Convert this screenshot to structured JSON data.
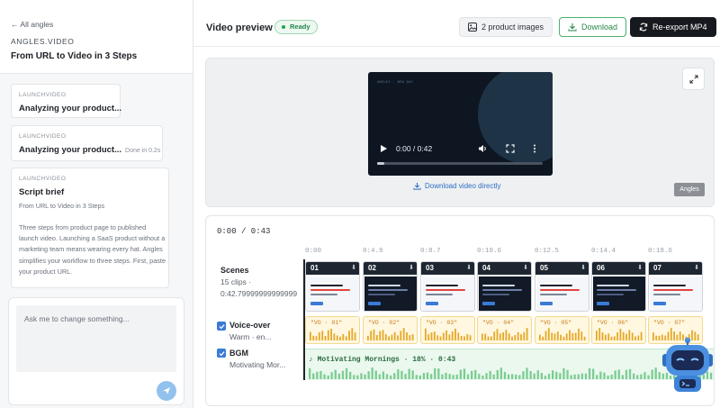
{
  "sidebar": {
    "back_label": "All angles",
    "brand": "ANGLES.VIDEO",
    "title": "From URL to Video in 3 Steps",
    "cards": [
      {
        "label": "LAUNCHVIDEO",
        "title": "Analyzing your product...",
        "meta": ""
      },
      {
        "label": "LAUNCHVIDEO",
        "title": "Analyzing your product...",
        "meta": "Done in 0.2s"
      },
      {
        "label": "LAUNCHVIDEO",
        "title": "Script brief",
        "subtitle": "From URL to Video in 3 Steps",
        "paragraph": "Three steps from product page to published launch video. Launching a SaaS product without a marketing team means wearing every hat. Angles simplifies your workflow to three steps. First, paste your product URL."
      }
    ],
    "chat": {
      "placeholder": "Ask me to change something..."
    }
  },
  "header": {
    "title": "Video preview",
    "status": "Ready",
    "images_button": "2 product images",
    "download_button": "Download",
    "reexport_button": "Re-export MP4"
  },
  "preview": {
    "video_small_text": "ANGLES · NEW DAY",
    "time_display": "0:00 / 0:42",
    "download_link": "Download video directly",
    "watermark": "Angles"
  },
  "timeline": {
    "current_time": "0:00 / 0:43",
    "ticks": [
      "0:00",
      "0:4.9",
      "0:8.7",
      "0:10.6",
      "0:12.5",
      "0:14.4",
      "0:18.6"
    ],
    "scenes_track": {
      "name": "Scenes",
      "sub1": "15 clips ·",
      "sub2": "0:42.79999999999999"
    },
    "scenes": [
      {
        "num": "01",
        "thumb": "light"
      },
      {
        "num": "02",
        "thumb": "dark"
      },
      {
        "num": "03",
        "thumb": "light"
      },
      {
        "num": "04",
        "thumb": "dark"
      },
      {
        "num": "05",
        "thumb": "light"
      },
      {
        "num": "06",
        "thumb": "dark"
      },
      {
        "num": "07",
        "thumb": "light"
      }
    ],
    "voiceover_track": {
      "name": "Voice-over",
      "sub": "Warm · en...",
      "checked": true
    },
    "voiceover_clips": [
      "\"VO · 01\"",
      "\"VO · 02\"",
      "\"VO · 03\"",
      "\"VO · 04\"",
      "\"VO · 05\"",
      "\"VO · 06\"",
      "\"VO · 07\""
    ],
    "bgm_track": {
      "name": "BGM",
      "sub": "Motivating Mor...",
      "checked": true
    },
    "bgm_clip": "♪ Motivating Mornings · 18% · 0:43"
  },
  "colors": {
    "accent_blue": "#3a7bd5",
    "ready_green": "#23874a",
    "vo_amber": "#c97a1a",
    "bgm_green": "#2a6a3e",
    "dark_button": "#16191d"
  }
}
